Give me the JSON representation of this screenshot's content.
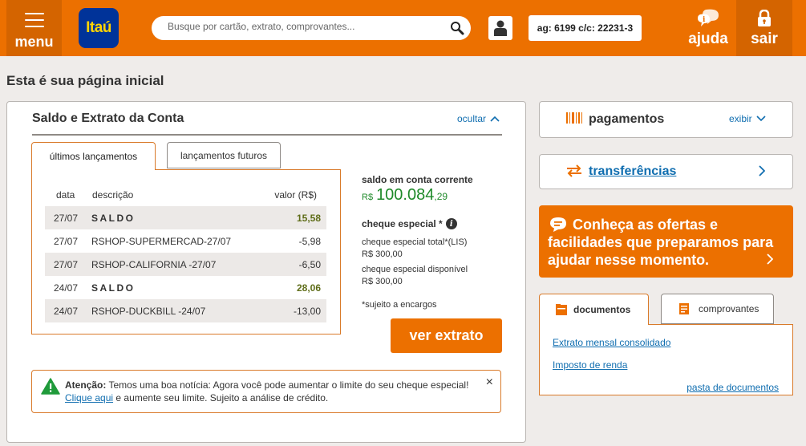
{
  "header": {
    "menu_label": "menu",
    "logo_text": "Itaú",
    "search_placeholder": "Busque por cartão, extrato, comprovantes...",
    "account_info": "ag: 6199 c/c: 22231-3",
    "help_label": "ajuda",
    "exit_label": "sair",
    "accent_color": "#ec7000",
    "brand_blue": "#003399"
  },
  "page_title": "Esta é sua página inicial",
  "account_card": {
    "title": "Saldo e Extrato da Conta",
    "hide_label": "ocultar",
    "tabs": [
      {
        "label": "últimos lançamentos",
        "active": true
      },
      {
        "label": "lançamentos futuros",
        "active": false
      }
    ],
    "columns": {
      "date": "data",
      "description": "descrição",
      "value": "valor (R$)"
    },
    "transactions": [
      {
        "date": "27/07",
        "description": "SALDO",
        "value": "15,58",
        "is_balance": true
      },
      {
        "date": "27/07",
        "description": "RSHOP-SUPERMERCAD-27/07",
        "value": "-5,98",
        "is_balance": false
      },
      {
        "date": "27/07",
        "description": "RSHOP-CALIFORNIA -27/07",
        "value": "-6,50",
        "is_balance": false
      },
      {
        "date": "24/07",
        "description": "SALDO",
        "value": "28,06",
        "is_balance": true
      },
      {
        "date": "24/07",
        "description": "RSHOP-DUCKBILL -24/07",
        "value": "-13,00",
        "is_balance": false
      }
    ],
    "balance": {
      "label": "saldo em conta corrente",
      "currency": "R$",
      "integer": "100.084",
      "decimal": ",29"
    },
    "overdraft": {
      "label": "cheque especial *",
      "total_label": "cheque especial total*(LIS)",
      "total_value": "R$ 300,00",
      "available_label": "cheque especial disponível",
      "available_value": "R$ 300,00",
      "footnote": "*sujeito a encargos"
    },
    "statement_button": "ver extrato",
    "alert": {
      "title": "Atenção:",
      "message": "Temos uma boa notícia: Agora você pode aumentar o limite do seu cheque especial!",
      "link": "Clique aqui",
      "message_end": "e aumente seu limite. Sujeito a análise de crédito.",
      "close": "×"
    }
  },
  "sidebar": {
    "payments": {
      "label": "pagamentos",
      "toggle": "exibir"
    },
    "transfers": {
      "label": "transferências"
    },
    "offer": {
      "text": "Conheça as ofertas e facilidades que preparamos para ajudar nesse momento."
    },
    "documents": {
      "tabs": [
        {
          "label": "documentos",
          "active": true
        },
        {
          "label": "comprovantes",
          "active": false
        }
      ],
      "links": [
        "Extrato mensal consolidado",
        "Imposto de renda"
      ],
      "folder_link": "pasta de documentos"
    }
  }
}
